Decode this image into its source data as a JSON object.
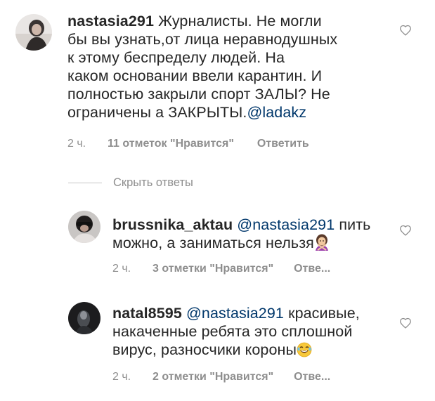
{
  "comment": {
    "username": "nastasia291",
    "text_lines": [
      "Журналисты. Не могли",
      "бы вы узнать,от лица неравнодушных",
      "к этому беспределу людей.  На",
      "каком основании ввели карантин. И",
      "полностью закрыли спорт ЗАЛЫ? Не",
      "ограничены а ЗАКРЫТЫ."
    ],
    "mention": "@ladakz",
    "time": "2 ч.",
    "likes": "11 отметок \"Нравится\"",
    "reply": "Ответить"
  },
  "hide_replies": "Скрыть ответы",
  "replies": [
    {
      "username": "brussnika_aktau",
      "mention": "@nastasia291",
      "text_line1_tail": "пить",
      "text_line2": "можно, а заниматься нельзя",
      "emoji": "woman-gesturing-no-emoji",
      "time": "2 ч.",
      "likes": "3 отметки \"Нравится\"",
      "reply": "Отве..."
    },
    {
      "username": "natal8595",
      "mention": "@nastasia291",
      "text_line1_tail": "красивые,",
      "text_line2": "накаченные ребята это сплошной",
      "text_line3": "вирус,  разносчики короны",
      "emoji": "laughing-emoji",
      "time": "2 ч.",
      "likes": "2 отметки \"Нравится\"",
      "reply": "Отве..."
    }
  ]
}
